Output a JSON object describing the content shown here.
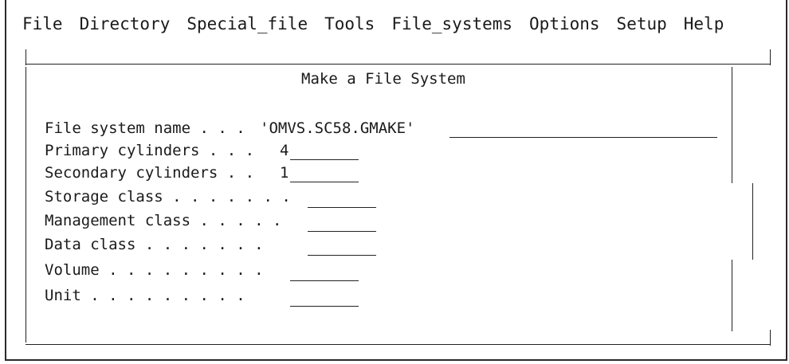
{
  "menu": [
    "File",
    "Directory",
    "Special_file",
    "Tools",
    "File_systems",
    "Options",
    "Setup",
    "Help"
  ],
  "dialog": {
    "title": "Make a File System",
    "fields": [
      {
        "label": "File system name . . .",
        "value": "'OMVS.SC58.GMAKE'"
      },
      {
        "label": "Primary cylinders . . .",
        "value": "4"
      },
      {
        "label": "Secondary cylinders . .",
        "value": "1"
      },
      {
        "label": "Storage class . . . . . . .",
        "value": ""
      },
      {
        "label": "Management class . . . . .",
        "value": ""
      },
      {
        "label": "Data class . . . . . . .",
        "value": ""
      },
      {
        "label": "Volume . . . . . . . . .",
        "value": ""
      },
      {
        "label": "Unit . . . . . . . . .",
        "value": ""
      }
    ]
  }
}
